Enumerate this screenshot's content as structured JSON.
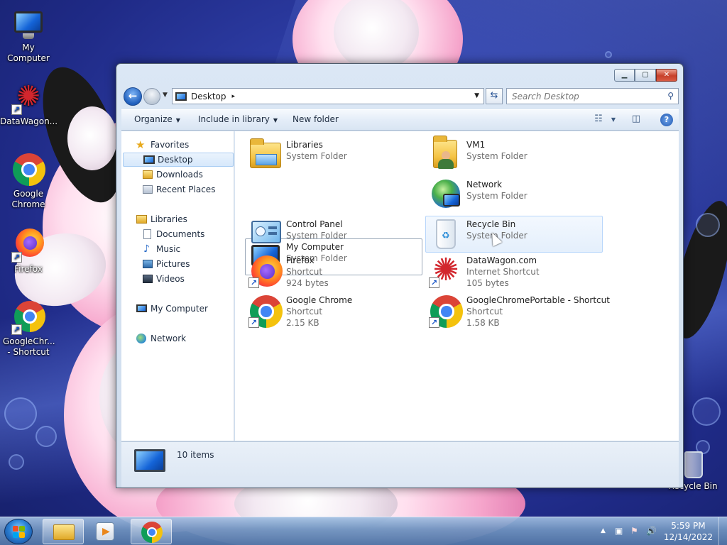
{
  "desktop": {
    "icons": [
      {
        "label": "My Computer"
      },
      {
        "label": "DataWagon..."
      },
      {
        "label": "Google Chrome"
      },
      {
        "label": "Firefox"
      },
      {
        "label": "GoogleChr... - Shortcut"
      },
      {
        "label": "Recycle Bin"
      }
    ]
  },
  "window": {
    "address": {
      "path": "Desktop",
      "separator": "▸"
    },
    "search": {
      "placeholder": "Search Desktop"
    },
    "toolbar": {
      "organize": "Organize",
      "include_in_library": "Include in library",
      "new_folder": "New folder"
    },
    "nav": {
      "favorites": "Favorites",
      "desktop": "Desktop",
      "downloads": "Downloads",
      "recent_places": "Recent Places",
      "libraries": "Libraries",
      "documents": "Documents",
      "music": "Music",
      "pictures": "Pictures",
      "videos": "Videos",
      "my_computer": "My Computer",
      "network": "Network"
    },
    "items": [
      {
        "name": "Libraries",
        "type": "System Folder",
        "size": ""
      },
      {
        "name": "VM1",
        "type": "System Folder",
        "size": ""
      },
      {
        "name": "My Computer",
        "type": "System Folder",
        "size": ""
      },
      {
        "name": "Network",
        "type": "System Folder",
        "size": ""
      },
      {
        "name": "Control Panel",
        "type": "System Folder",
        "size": ""
      },
      {
        "name": "Recycle Bin",
        "type": "System Folder",
        "size": ""
      },
      {
        "name": "Firefox",
        "type": "Shortcut",
        "size": "924 bytes"
      },
      {
        "name": "DataWagon.com",
        "type": "Internet Shortcut",
        "size": "105 bytes"
      },
      {
        "name": "Google Chrome",
        "type": "Shortcut",
        "size": "2.15 KB"
      },
      {
        "name": "GoogleChromePortable - Shortcut",
        "type": "Shortcut",
        "size": "1.58 KB"
      }
    ],
    "status": {
      "count": "10 items"
    }
  },
  "taskbar": {
    "clock_time": "5:59 PM",
    "clock_date": "12/14/2022"
  },
  "colors": {
    "accent": "#1f5fbd",
    "selection": "#d6e8fb"
  }
}
